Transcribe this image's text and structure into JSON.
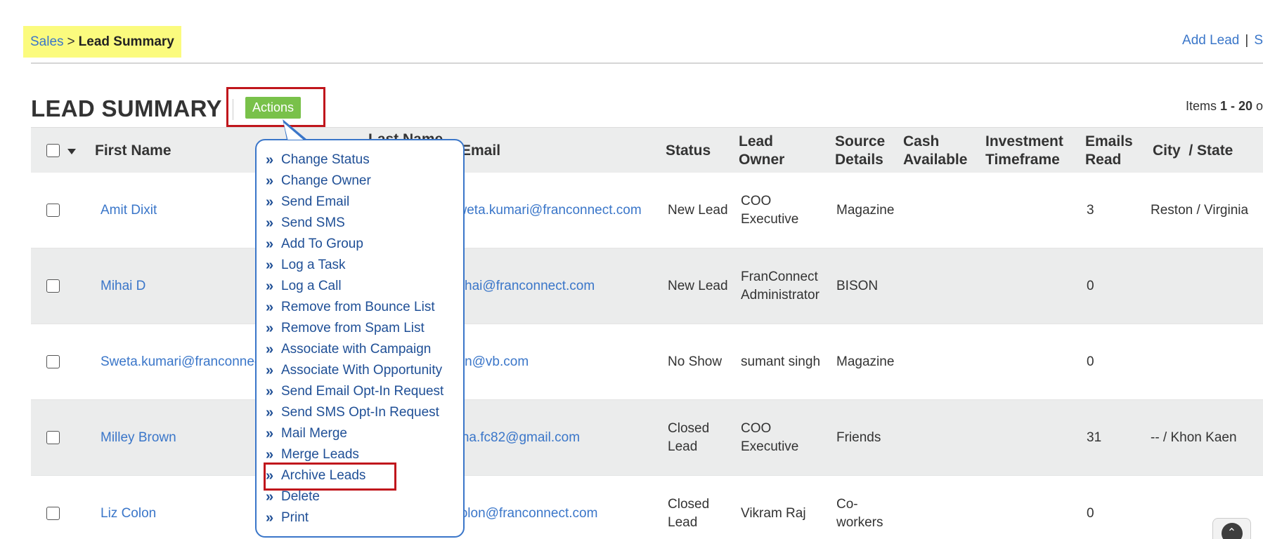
{
  "breadcrumb": {
    "parent": "Sales",
    "separator": ">",
    "current": "Lead Summary"
  },
  "top_links": {
    "add_lead": "Add  Lead",
    "pipe": "|",
    "cut_link": "S"
  },
  "page": {
    "title": "LEAD SUMMARY",
    "actions_label": "Actions",
    "items_prefix": "Items ",
    "items_range": "1 - 20",
    "items_suffix": " o"
  },
  "table": {
    "headers": {
      "first_name": "First Name",
      "last_name": "Last Name",
      "email": "Email",
      "status": "Status",
      "lead_owner": "Lead Owner",
      "source_details": "Source Details",
      "cash_available": "Cash Available",
      "investment_timeframe": "Investment Timeframe",
      "emails_read": "Emails Read",
      "city_state": "City  / State"
    },
    "rows": [
      {
        "first_name": "Amit Dixit",
        "email": "sweta.kumari@franconnect.com",
        "status": "New Lead",
        "owner": "COO Executive",
        "source": "Magazine",
        "emails_read": "3",
        "city_state": "Reston / Virginia"
      },
      {
        "first_name": "Mihai D",
        "email": "mihai@franconnect.com",
        "status": "New Lead",
        "owner": "FranConnect Administrator",
        "source": "BISON",
        "emails_read": "0",
        "city_state": ""
      },
      {
        "first_name": "Sweta.kumari@franconnect.com",
        "email": "sen@vb.com",
        "status": "No Show",
        "owner": "sumant singh",
        "source": "Magazine",
        "emails_read": "0",
        "city_state": ""
      },
      {
        "first_name": "Milley Brown",
        "email": "mna.fc82@gmail.com",
        "status": "Closed Lead",
        "owner": "COO Executive",
        "source": "Friends",
        "emails_read": "31",
        "city_state": "-- / Khon Kaen"
      },
      {
        "first_name": "Liz Colon",
        "email": "lcolon@franconnect.com",
        "status": "Closed Lead",
        "owner": "Vikram Raj",
        "source": "Co-workers",
        "emails_read": "0",
        "city_state": ""
      }
    ]
  },
  "actions_menu": {
    "items": [
      "Change Status",
      "Change Owner",
      "Send Email",
      "Send SMS",
      "Add To Group",
      "Log a Task",
      "Log a Call",
      "Remove from Bounce List",
      "Remove from Spam List",
      "Associate with Campaign",
      "Associate With Opportunity",
      "Send Email Opt-In Request",
      "Send SMS Opt-In Request",
      "Mail Merge",
      "Merge Leads",
      "Archive Leads",
      "Delete",
      "Print"
    ],
    "bullet": "»"
  },
  "colors": {
    "link": "#3a76c9",
    "actions_button": "#79c14a",
    "highlight_frame": "#c0161c",
    "breadcrumb_bg": "#fbfb7e"
  }
}
